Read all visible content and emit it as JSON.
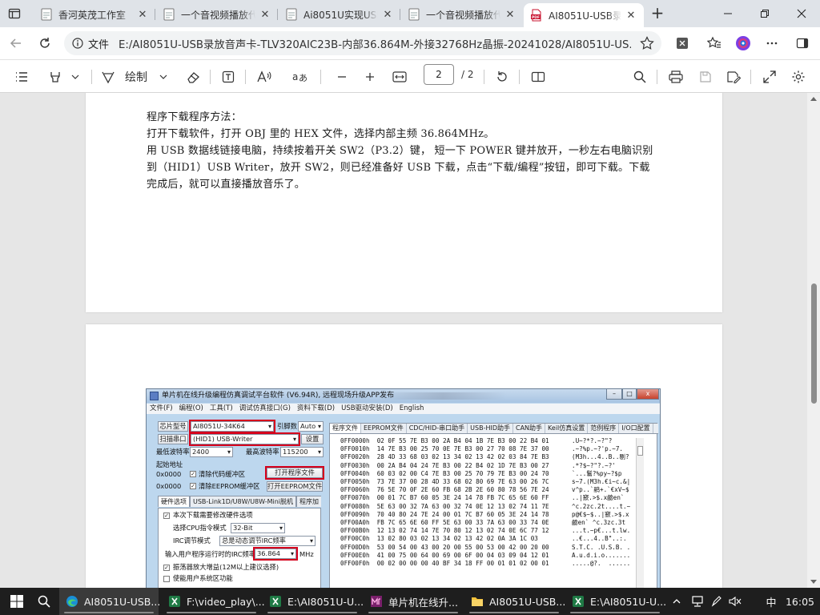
{
  "browser": {
    "tabs": [
      {
        "title": "香河英茂工作室",
        "icon": "page-icon",
        "active": false
      },
      {
        "title": "一个音视频播放代",
        "icon": "page-icon",
        "active": false
      },
      {
        "title": "Ai8051U实现USB",
        "icon": "page-icon",
        "active": false
      },
      {
        "title": "一个音视频播放代",
        "icon": "page-icon",
        "active": false
      },
      {
        "title": "AI8051U-USB录放",
        "icon": "pdf-icon",
        "active": true
      }
    ],
    "close_glyph": "✕",
    "new_tab_glyph": "+",
    "address": {
      "scheme_label": "文件",
      "url": "E:/AI8051U-USB录放音声卡-TLV320AIC23B-内部36.864M-外接32768Hz晶振-20241028/AI8051U-US..."
    }
  },
  "pdf_toolbar": {
    "draw_label": "绘制",
    "current_page": "2",
    "page_count": "/ 2"
  },
  "document": {
    "page1_lines": [
      "程序下载程序方法：",
      "打开下载软件，打开 OBJ 里的 HEX 文件，选择内部主频 36.864MHz。",
      "用 USB 数据线链接电脑，持续按着开关 SW2（P3.2）键，  短一下 POWER 键并放开，一秒左右电脑识别",
      "到（HID1）USB Writer，放开 SW2，则已经准备好 USB 下载，点击“下载/编程”按钮，即可下载。下载",
      "完成后，就可以直接播放音乐了。"
    ]
  },
  "embedded_app": {
    "title": "单片机在线升级编程仿真调试平台软件 (V6.94R), 远程现场升级APP发布",
    "menu": [
      "文件(F)",
      "编程(O)",
      "工具(T)",
      "调试仿真接口(G)",
      "资料下载(D)",
      "USB驱动安装(D)",
      "English"
    ],
    "chip_button": "芯片型号",
    "chip_value": "AI8051U-34K64",
    "pin_label": "引脚数",
    "pin_value": "Auto",
    "scan_button": "扫描串口",
    "port_value": "(HID1) USB-Writer",
    "settings_button": "设置",
    "min_baud_label": "最低波特率",
    "min_baud_value": "2400",
    "max_baud_label": "最高波特率",
    "max_baud_value": "115200",
    "start_addr_label": "起始地址",
    "addr1": "0x0000",
    "clear_code_label": "清除代码缓冲区",
    "open_prog_button": "打开程序文件",
    "addr2": "0x0000",
    "clear_eeprom_label": "清除EEPROM缓冲区",
    "open_eeprom_button": "打开EEPROM文件",
    "subtabs": [
      "硬件选项",
      "USB-Link1D/U8W/U8W-Mini脱机",
      "程序加"
    ],
    "opt_reset_label": "本次下载需要修改硬件选项",
    "cpu_mode_label": "选择CPU指令模式",
    "cpu_mode_value": "32-Bit",
    "irc_mode_label": "IRC调节模式",
    "irc_mode_value": "总是动态调节IRC频率",
    "freq_label": "输入用户程序运行时的IRC频率",
    "freq_value": "36.864",
    "freq_unit": "MHz",
    "osc_gain_label": "振荡器放大增益(12M以上建议选择)",
    "sys_reset_label": "使能用户系统区功能",
    "hex_tabs": [
      "程序文件",
      "EEPROM文件",
      "CDC/HID-串口助手",
      "USB-HID助手",
      "CAN助手",
      "Keil仿真设置",
      "范例程序",
      "I/O口配置"
    ],
    "hex_rows": [
      {
        "addr": "0FF0000h",
        "bytes": "02 0F 55 7E B3 00 2A B4 04 1B 7E B3 00 22 B4 01",
        "ascii": ".U~?*?.~?\"?"
      },
      {
        "addr": "0FF0010h",
        "bytes": "14 7E B3 00 25 70 0E 7E B3 00 27 70 08 7E 37 00",
        "ascii": ".~?%p.~?'p.~7."
      },
      {
        "addr": "0FF0020h",
        "bytes": "28 4D 33 68 03 02 13 34 02 13 42 02 03 84 7E B3",
        "ascii": "(M3h...4..B..剔?"
      },
      {
        "addr": "0FF0030h",
        "bytes": "00 2A B4 04 24 7E B3 00 22 B4 02 1D 7E B3 00 27",
        "ascii": ".*?$~?\"?.~?'"
      },
      {
        "addr": "0FF0040h",
        "bytes": "60 03 02 00 C4 7E B3 00 25 70 79 7E B3 00 24 70",
        "ascii": "`...鬄?%py~?$p"
      },
      {
        "addr": "0FF0050h",
        "bytes": "73 7E 37 00 28 4D 33 68 02 80 69 7E 63 00 26 7C",
        "ascii": "s~7.(M3h.€i~c.&|"
      },
      {
        "addr": "0FF0060h",
        "bytes": "76 5E 70 0F 2E 60 FB 68 2B 2E 60 80 78 56 7E 24",
        "ascii": "v^p..`鹝+.`€xV~$"
      },
      {
        "addr": "0FF0070h",
        "bytes": "00 01 7C B7 60 05 3E 24 14 78 FB 7C 65 6E 60 FF",
        "ascii": "..|窾.>$.x鹼en`"
      },
      {
        "addr": "0FF0080h",
        "bytes": "5E 63 00 32 7A 63 00 32 74 0E 12 13 02 74 11 7E",
        "ascii": "^c.2zc.2t....t.~"
      },
      {
        "addr": "0FF0090h",
        "bytes": "70 40 80 24 7E 24 00 01 7C B7 60 05 3E 24 14 78",
        "ascii": "p@€$~$..|窾.>$.x"
      },
      {
        "addr": "0FF00A0h",
        "bytes": "FB 7C 65 6E 60 FF 5E 63 00 33 7A 63 00 33 74 0E",
        "ascii": "鹼en` ^c.3zc.3t"
      },
      {
        "addr": "0FF00B0h",
        "bytes": "12 13 02 74 14 7E 70 80 12 13 02 74 0E 6C 77 12",
        "ascii": "...t.~p€...t.lw."
      },
      {
        "addr": "0FF00C0h",
        "bytes": "13 02 80 03 02 13 34 02 13 42 02 0A 3A 1C 03",
        "ascii": "..€...4..B\"..:."
      },
      {
        "addr": "0FF00D0h",
        "bytes": "53 00 54 00 43 00 20 00 55 00 53 00 42 00 20 00",
        "ascii": "S.T.C. .U.S.B. ."
      },
      {
        "addr": "0FF00E0h",
        "bytes": "41 00 75 00 64 00 69 00 6F 00 04 03 09 04 12 01",
        "ascii": "A.u.d.i.o......."
      },
      {
        "addr": "0FF00F0h",
        "bytes": "00 02 00 00 00 40 BF 34 18 FF 00 01 01 02 00 01",
        "ascii": ".....@?.  ......"
      }
    ]
  },
  "taskbar": {
    "items": [
      {
        "label": "AI8051U-USB...",
        "icon": "edge-icon"
      },
      {
        "label": "F:\\video_play\\...",
        "icon": "excel-icon"
      },
      {
        "label": "E:\\AI8051U-U...",
        "icon": "excel-icon"
      },
      {
        "label": "单片机在线升...",
        "icon": "stc-isp-icon"
      },
      {
        "label": "AI8051U-USB...",
        "icon": "folder-icon"
      },
      {
        "label": "E:\\AI8051U-U...",
        "icon": "excel-icon"
      }
    ],
    "ime_label": "中",
    "clock": "16:05"
  },
  "colors": {
    "highlight_red": "#d6001c",
    "pdf_icon_red": "#c8102e",
    "tab_bar": "#dfe3e8"
  }
}
